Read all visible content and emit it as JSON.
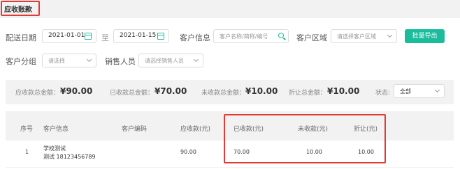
{
  "title": "应收账款",
  "filters": {
    "date_label": "配送日期",
    "date_start": "2021-01-01",
    "date_sep": "至",
    "date_end": "2021-01-15",
    "customer_info_label": "客户信息",
    "customer_info_placeholder": "客户名称/简称/编号",
    "customer_region_label": "客户区域",
    "customer_region_placeholder": "请选择客户区域",
    "export_button": "批量导出",
    "customer_group_label": "客户分组",
    "customer_group_placeholder": "请选择",
    "salesperson_label": "销售人员",
    "salesperson_placeholder": "请选择销售人员"
  },
  "summary": {
    "receivable_label": "应收款总金额：",
    "receivable_value": "¥90.00",
    "received_label": "已收款总金额：",
    "received_value": "¥70.00",
    "unreceived_label": "未收款总金额：",
    "unreceived_value": "¥10.00",
    "discount_label": "折让总金额：",
    "discount_value": "¥10.00",
    "status_label": "状态:",
    "status_value": "全部"
  },
  "table": {
    "headers": [
      "序号",
      "客户信息",
      "客户编码",
      "应收款(元)",
      "已收款(元)",
      "未收款(元)",
      "折让(元)"
    ],
    "rows": [
      {
        "index": "1",
        "customer_name": "学校测试",
        "customer_contact": "测试  18123456789",
        "customer_code": "",
        "receivable": "90.00",
        "received": "70.00",
        "unreceived": "10.00",
        "discount": "10.00"
      }
    ]
  },
  "colors": {
    "accent": "#1abc9c",
    "highlight": "#e53935"
  }
}
